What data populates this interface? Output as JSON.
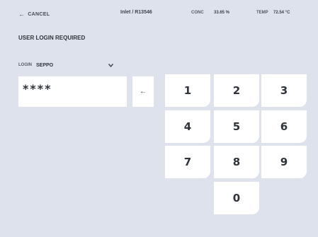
{
  "header": {
    "cancel_label": "CANCEL",
    "location": "Inlet / R13546",
    "conc_label": "CONC",
    "conc_value": "33.65 %",
    "temp_label": "TEMP",
    "temp_value": "72.54 °C"
  },
  "page": {
    "title": "USER LOGIN REQUIRED"
  },
  "login": {
    "label": "LOGIN",
    "selected_user": "SEPPO"
  },
  "pin": {
    "masked_value": "****"
  },
  "keypad": {
    "backspace": "←",
    "keys": [
      "1",
      "2",
      "3",
      "4",
      "5",
      "6",
      "7",
      "8",
      "9",
      "0"
    ]
  },
  "icons": {
    "cancel": "arrow-left-icon",
    "login_dropdown": "chevron-down-icon",
    "backspace": "arrow-left-icon"
  },
  "colors": {
    "background": "#dde2ec",
    "key_background": "#ffffff",
    "text": "#2f333a"
  }
}
